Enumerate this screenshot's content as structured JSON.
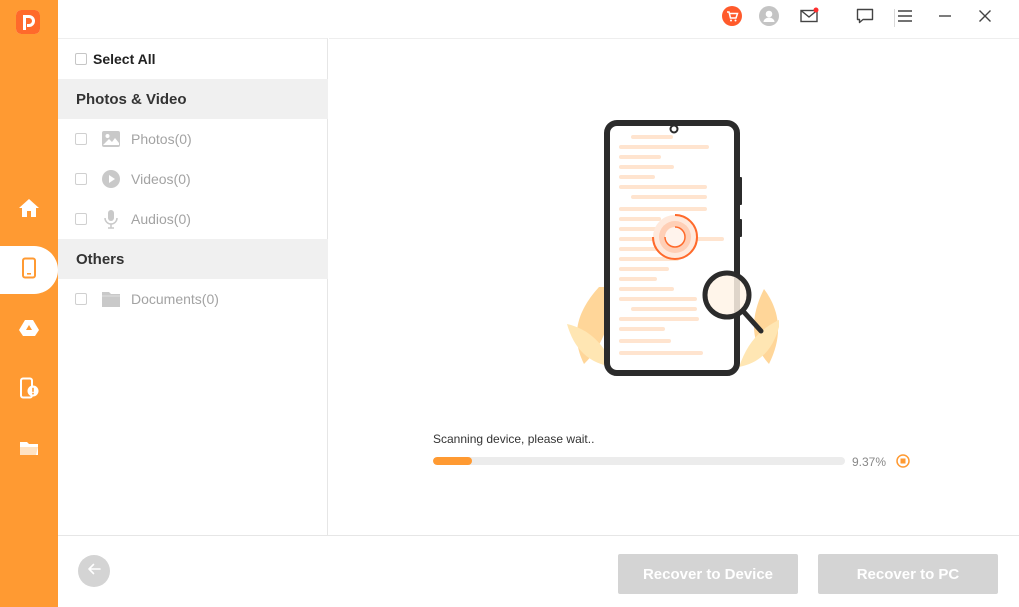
{
  "colors": {
    "accent": "#ff9a32",
    "disabled": "#d4d4d4",
    "group_bg": "#f0f0f0"
  },
  "sidebar": {
    "items": [
      {
        "name": "home",
        "icon": "home-icon"
      },
      {
        "name": "phone",
        "icon": "phone-icon",
        "active": true
      },
      {
        "name": "google-drive",
        "icon": "drive-icon"
      },
      {
        "name": "phone-alert",
        "icon": "phone-alert-icon"
      },
      {
        "name": "folder",
        "icon": "folder-icon"
      }
    ]
  },
  "titlebar": {
    "icons": [
      "cart-icon",
      "user-icon",
      "mail-icon",
      "feedback-icon",
      "menu-icon",
      "minimize-icon",
      "close-icon"
    ]
  },
  "categories": {
    "select_all": "Select All",
    "groups": [
      {
        "title": "Photos & Video",
        "items": [
          {
            "label": "Photos(0)",
            "icon": "photo-icon"
          },
          {
            "label": "Videos(0)",
            "icon": "video-icon"
          },
          {
            "label": "Audios(0)",
            "icon": "microphone-icon"
          }
        ]
      },
      {
        "title": "Others",
        "items": [
          {
            "label": "Documents(0)",
            "icon": "folder-icon"
          }
        ]
      }
    ]
  },
  "scan": {
    "status": "Scanning device, please wait..",
    "percent_text": "9.37%",
    "progress": 0.0937
  },
  "footer": {
    "recover_device": "Recover to Device",
    "recover_pc": "Recover to PC"
  }
}
